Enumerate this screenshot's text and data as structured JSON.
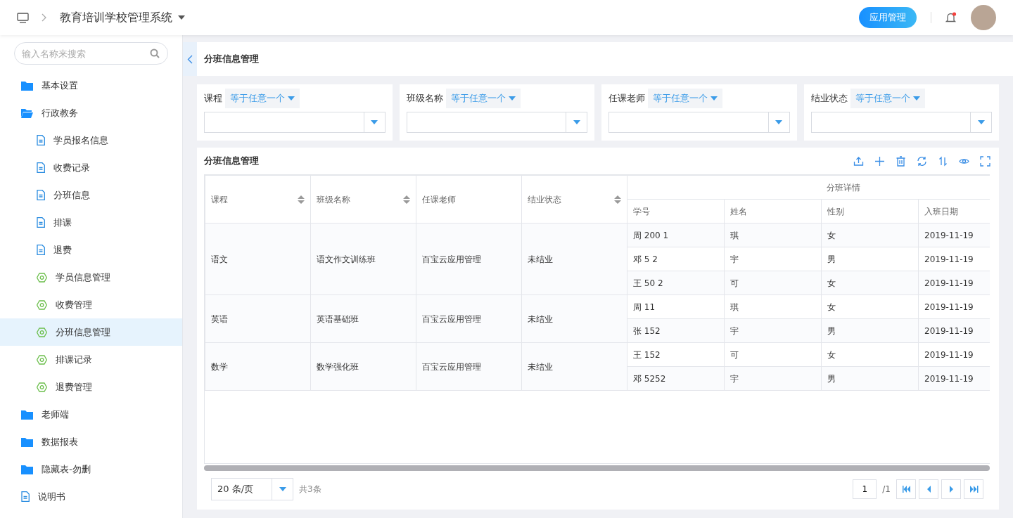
{
  "header": {
    "title": "教育培训学校管理系统",
    "app_button": "应用管理"
  },
  "sidebar": {
    "search_placeholder": "输入名称来搜索",
    "items": [
      {
        "kind": "folder",
        "label": "基本设置",
        "expanded": false,
        "selected": false
      },
      {
        "kind": "folder",
        "label": "行政教务",
        "expanded": true,
        "selected": false,
        "children": [
          {
            "kind": "doc",
            "label": "学员报名信息",
            "selected": false
          },
          {
            "kind": "doc",
            "label": "收费记录",
            "selected": false
          },
          {
            "kind": "doc",
            "label": "分班信息",
            "selected": false
          },
          {
            "kind": "doc",
            "label": "排课",
            "selected": false
          },
          {
            "kind": "doc",
            "label": "退费",
            "selected": false
          },
          {
            "kind": "module",
            "label": "学员信息管理",
            "selected": false
          },
          {
            "kind": "module",
            "label": "收费管理",
            "selected": false
          },
          {
            "kind": "module",
            "label": "分班信息管理",
            "selected": true
          },
          {
            "kind": "module",
            "label": "排课记录",
            "selected": false
          },
          {
            "kind": "module",
            "label": "退费管理",
            "selected": false
          }
        ]
      },
      {
        "kind": "folder",
        "label": "老师端",
        "expanded": false,
        "selected": false
      },
      {
        "kind": "folder",
        "label": "数据报表",
        "expanded": false,
        "selected": false
      },
      {
        "kind": "folder",
        "label": "隐藏表-勿删",
        "expanded": false,
        "selected": false
      },
      {
        "kind": "doc",
        "label": "说明书",
        "selected": false
      }
    ]
  },
  "page_title": "分班信息管理",
  "filters": [
    {
      "label": "课程",
      "operator": "等于任意一个"
    },
    {
      "label": "班级名称",
      "operator": "等于任意一个"
    },
    {
      "label": "任课老师",
      "operator": "等于任意一个"
    },
    {
      "label": "结业状态",
      "operator": "等于任意一个"
    }
  ],
  "table": {
    "title": "分班信息管理",
    "group_header": "分班详情",
    "columns": [
      {
        "label": "课程",
        "sortable": true
      },
      {
        "label": "班级名称",
        "sortable": true
      },
      {
        "label": "任课老师",
        "sortable": false
      },
      {
        "label": "结业状态",
        "sortable": true
      }
    ],
    "detail_columns": [
      "学号",
      "姓名",
      "性别",
      "入班日期"
    ],
    "groups": [
      {
        "cells": [
          "语文",
          "语文作文训练班",
          "百宝云应用管理",
          "未结业"
        ],
        "students": [
          {
            "id": "周 200 1",
            "name": "琪",
            "gender": "女",
            "date": "2019-11-19"
          },
          {
            "id": "邓 5 2",
            "name": "宇",
            "gender": "男",
            "date": "2019-11-19"
          },
          {
            "id": "王 50 2",
            "name": "可",
            "gender": "女",
            "date": "2019-11-19"
          }
        ]
      },
      {
        "cells": [
          "英语",
          "英语基础班",
          "百宝云应用管理",
          "未结业"
        ],
        "students": [
          {
            "id": "周 11",
            "name": "琪",
            "gender": "女",
            "date": "2019-11-19"
          },
          {
            "id": "张 152",
            "name": "宇",
            "gender": "男",
            "date": "2019-11-19"
          }
        ]
      },
      {
        "cells": [
          "数学",
          "数学强化班",
          "百宝云应用管理",
          "未结业"
        ],
        "students": [
          {
            "id": "王 152",
            "name": "可",
            "gender": "女",
            "date": "2019-11-19"
          },
          {
            "id": "邓 5252",
            "name": "宇",
            "gender": "男",
            "date": "2019-11-19"
          }
        ]
      }
    ]
  },
  "pagination": {
    "page_size": "20 条/页",
    "total": "共3条",
    "page": "1",
    "pages": "/1"
  }
}
